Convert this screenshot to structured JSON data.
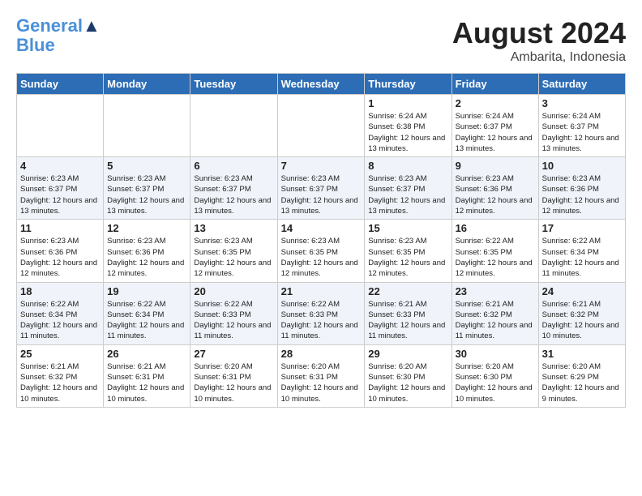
{
  "header": {
    "logo_line1": "General",
    "logo_line2": "Blue",
    "month_year": "August 2024",
    "location": "Ambarita, Indonesia"
  },
  "weekdays": [
    "Sunday",
    "Monday",
    "Tuesday",
    "Wednesday",
    "Thursday",
    "Friday",
    "Saturday"
  ],
  "weeks": [
    [
      {
        "day": "",
        "info": ""
      },
      {
        "day": "",
        "info": ""
      },
      {
        "day": "",
        "info": ""
      },
      {
        "day": "",
        "info": ""
      },
      {
        "day": "1",
        "info": "Sunrise: 6:24 AM\nSunset: 6:38 PM\nDaylight: 12 hours\nand 13 minutes."
      },
      {
        "day": "2",
        "info": "Sunrise: 6:24 AM\nSunset: 6:37 PM\nDaylight: 12 hours\nand 13 minutes."
      },
      {
        "day": "3",
        "info": "Sunrise: 6:24 AM\nSunset: 6:37 PM\nDaylight: 12 hours\nand 13 minutes."
      }
    ],
    [
      {
        "day": "4",
        "info": "Sunrise: 6:23 AM\nSunset: 6:37 PM\nDaylight: 12 hours\nand 13 minutes."
      },
      {
        "day": "5",
        "info": "Sunrise: 6:23 AM\nSunset: 6:37 PM\nDaylight: 12 hours\nand 13 minutes."
      },
      {
        "day": "6",
        "info": "Sunrise: 6:23 AM\nSunset: 6:37 PM\nDaylight: 12 hours\nand 13 minutes."
      },
      {
        "day": "7",
        "info": "Sunrise: 6:23 AM\nSunset: 6:37 PM\nDaylight: 12 hours\nand 13 minutes."
      },
      {
        "day": "8",
        "info": "Sunrise: 6:23 AM\nSunset: 6:37 PM\nDaylight: 12 hours\nand 13 minutes."
      },
      {
        "day": "9",
        "info": "Sunrise: 6:23 AM\nSunset: 6:36 PM\nDaylight: 12 hours\nand 12 minutes."
      },
      {
        "day": "10",
        "info": "Sunrise: 6:23 AM\nSunset: 6:36 PM\nDaylight: 12 hours\nand 12 minutes."
      }
    ],
    [
      {
        "day": "11",
        "info": "Sunrise: 6:23 AM\nSunset: 6:36 PM\nDaylight: 12 hours\nand 12 minutes."
      },
      {
        "day": "12",
        "info": "Sunrise: 6:23 AM\nSunset: 6:36 PM\nDaylight: 12 hours\nand 12 minutes."
      },
      {
        "day": "13",
        "info": "Sunrise: 6:23 AM\nSunset: 6:35 PM\nDaylight: 12 hours\nand 12 minutes."
      },
      {
        "day": "14",
        "info": "Sunrise: 6:23 AM\nSunset: 6:35 PM\nDaylight: 12 hours\nand 12 minutes."
      },
      {
        "day": "15",
        "info": "Sunrise: 6:23 AM\nSunset: 6:35 PM\nDaylight: 12 hours\nand 12 minutes."
      },
      {
        "day": "16",
        "info": "Sunrise: 6:22 AM\nSunset: 6:35 PM\nDaylight: 12 hours\nand 12 minutes."
      },
      {
        "day": "17",
        "info": "Sunrise: 6:22 AM\nSunset: 6:34 PM\nDaylight: 12 hours\nand 11 minutes."
      }
    ],
    [
      {
        "day": "18",
        "info": "Sunrise: 6:22 AM\nSunset: 6:34 PM\nDaylight: 12 hours\nand 11 minutes."
      },
      {
        "day": "19",
        "info": "Sunrise: 6:22 AM\nSunset: 6:34 PM\nDaylight: 12 hours\nand 11 minutes."
      },
      {
        "day": "20",
        "info": "Sunrise: 6:22 AM\nSunset: 6:33 PM\nDaylight: 12 hours\nand 11 minutes."
      },
      {
        "day": "21",
        "info": "Sunrise: 6:22 AM\nSunset: 6:33 PM\nDaylight: 12 hours\nand 11 minutes."
      },
      {
        "day": "22",
        "info": "Sunrise: 6:21 AM\nSunset: 6:33 PM\nDaylight: 12 hours\nand 11 minutes."
      },
      {
        "day": "23",
        "info": "Sunrise: 6:21 AM\nSunset: 6:32 PM\nDaylight: 12 hours\nand 11 minutes."
      },
      {
        "day": "24",
        "info": "Sunrise: 6:21 AM\nSunset: 6:32 PM\nDaylight: 12 hours\nand 10 minutes."
      }
    ],
    [
      {
        "day": "25",
        "info": "Sunrise: 6:21 AM\nSunset: 6:32 PM\nDaylight: 12 hours\nand 10 minutes."
      },
      {
        "day": "26",
        "info": "Sunrise: 6:21 AM\nSunset: 6:31 PM\nDaylight: 12 hours\nand 10 minutes."
      },
      {
        "day": "27",
        "info": "Sunrise: 6:20 AM\nSunset: 6:31 PM\nDaylight: 12 hours\nand 10 minutes."
      },
      {
        "day": "28",
        "info": "Sunrise: 6:20 AM\nSunset: 6:31 PM\nDaylight: 12 hours\nand 10 minutes."
      },
      {
        "day": "29",
        "info": "Sunrise: 6:20 AM\nSunset: 6:30 PM\nDaylight: 12 hours\nand 10 minutes."
      },
      {
        "day": "30",
        "info": "Sunrise: 6:20 AM\nSunset: 6:30 PM\nDaylight: 12 hours\nand 10 minutes."
      },
      {
        "day": "31",
        "info": "Sunrise: 6:20 AM\nSunset: 6:29 PM\nDaylight: 12 hours\nand 9 minutes."
      }
    ]
  ]
}
